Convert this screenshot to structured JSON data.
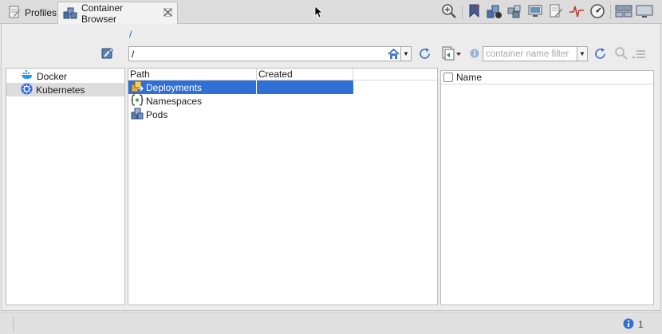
{
  "tabs": [
    {
      "label": "Profiles",
      "icon": "profiles-icon"
    },
    {
      "label": "Container Browser",
      "icon": "container-browser-icon",
      "active": true
    }
  ],
  "path": {
    "breadcrumb": "/",
    "value": "/"
  },
  "filter": {
    "placeholder": "container name filter"
  },
  "tree": [
    {
      "label": "Docker",
      "icon": "docker-icon"
    },
    {
      "label": "Kubernetes",
      "icon": "kubernetes-icon",
      "selected": true
    }
  ],
  "table": {
    "columns": [
      "Path",
      "Created"
    ],
    "rows": [
      {
        "path": "Deployments",
        "created": "",
        "icon": "deployments-icon",
        "selected": true
      },
      {
        "path": "Namespaces",
        "created": "",
        "icon": "namespaces-icon"
      },
      {
        "path": "Pods",
        "created": "",
        "icon": "pods-icon"
      }
    ]
  },
  "details": {
    "column": "Name"
  },
  "status": {
    "count": "1"
  },
  "colors": {
    "selection": "#2f6fd6",
    "link": "#2a59c2"
  }
}
